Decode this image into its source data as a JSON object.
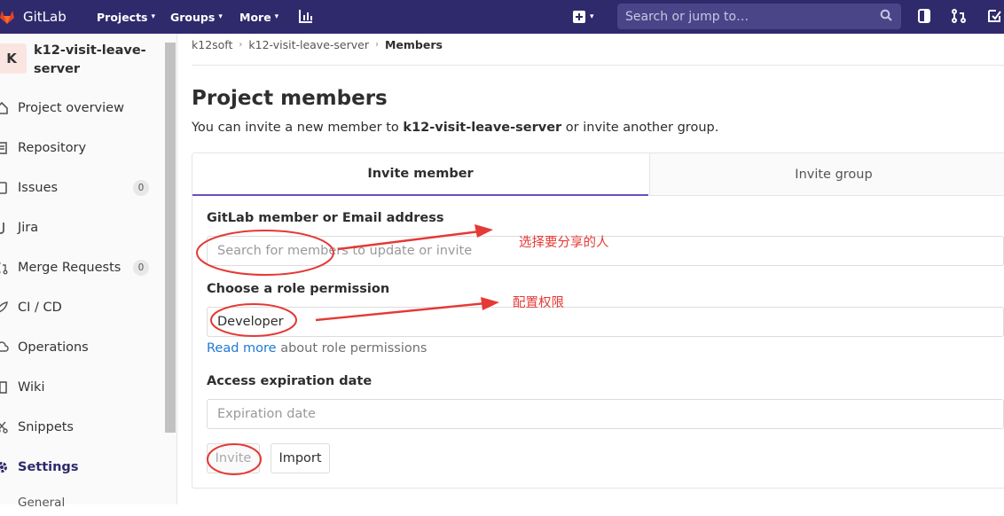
{
  "topbar": {
    "brand": "GitLab",
    "nav": [
      {
        "label": "Projects"
      },
      {
        "label": "Groups"
      },
      {
        "label": "More"
      }
    ],
    "search_placeholder": "Search or jump to…"
  },
  "sidebar": {
    "avatar_letter": "K",
    "project_name": "k12-visit-leave-server",
    "items": [
      {
        "label": "Project overview",
        "icon": "home-icon"
      },
      {
        "label": "Repository",
        "icon": "doc-icon"
      },
      {
        "label": "Issues",
        "icon": "issues-icon",
        "count": "0"
      },
      {
        "label": "Jira",
        "icon": "jira-icon"
      },
      {
        "label": "Merge Requests",
        "icon": "merge-request-icon",
        "count": "0"
      },
      {
        "label": "CI / CD",
        "icon": "rocket-icon"
      },
      {
        "label": "Operations",
        "icon": "cloud-icon"
      },
      {
        "label": "Wiki",
        "icon": "book-icon"
      },
      {
        "label": "Snippets",
        "icon": "scissors-icon"
      },
      {
        "label": "Settings",
        "icon": "gear-icon"
      },
      {
        "label": "General"
      }
    ]
  },
  "breadcrumb": {
    "items": [
      "k12soft",
      "k12-visit-leave-server"
    ],
    "current": "Members"
  },
  "main": {
    "title": "Project members",
    "intro_prefix": "You can invite a new member to ",
    "intro_project": "k12-visit-leave-server",
    "intro_suffix": " or invite another group.",
    "tabs": {
      "invite_member": "Invite member",
      "invite_group": "Invite group"
    },
    "form": {
      "member_label": "GitLab member or Email address",
      "member_placeholder": "Search for members to update or invite",
      "role_label": "Choose a role permission",
      "role_value": "Developer",
      "help_link": "Read more",
      "help_text": " about role permissions",
      "expiry_label": "Access expiration date",
      "expiry_placeholder": "Expiration date",
      "invite_button": "Invite",
      "import_button": "Import"
    }
  },
  "annotations": {
    "members_note": "选择要分享的人",
    "role_note": "配置权限"
  },
  "colors": {
    "topbar": "#2f2a6b",
    "accent": "#6b4fbb",
    "annotation": "#e53935",
    "link": "#1f78d1"
  }
}
